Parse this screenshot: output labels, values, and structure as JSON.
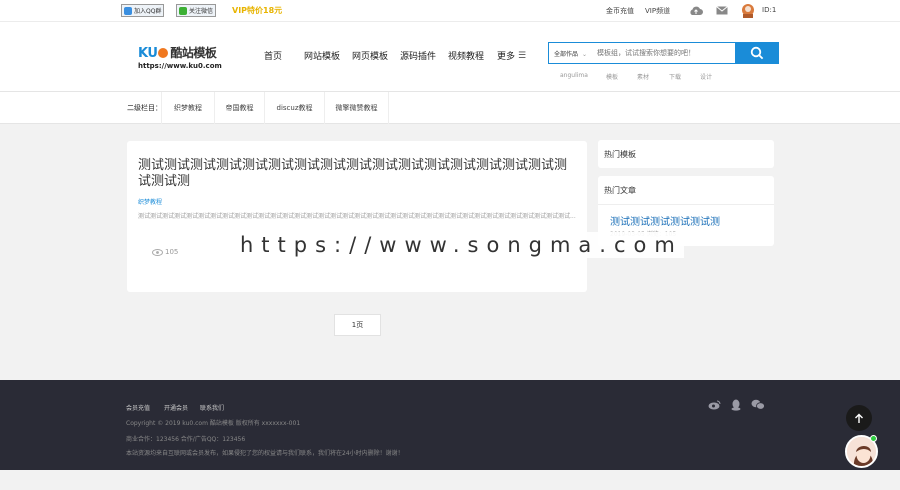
{
  "topbar": {
    "qq_group": "加入QQ群",
    "wechat_follow": "关注微信",
    "vip_promo": "VIP特价18元",
    "links": [
      "金币充值",
      "VIP频道"
    ],
    "user_id": "ID:1"
  },
  "header": {
    "logo_brand": "KU",
    "logo_name": "酷站模板",
    "logo_url": "https://www.ku0.com",
    "nav": [
      "首页",
      "网站模板",
      "网页模板",
      "源码插件",
      "视频教程",
      "更多"
    ],
    "search": {
      "category": "全部作品",
      "placeholder": "模板组，试试搜索你想要的吧！"
    },
    "hot_keywords": [
      "angulima",
      "模板",
      "素材",
      "下载",
      "设计"
    ]
  },
  "subnav": {
    "label": "二级栏目：",
    "items": [
      "织梦教程",
      "帝国教程",
      "discuz教程",
      "微擎微赞教程"
    ]
  },
  "article": {
    "title": "测试测试测试测试测试测试测试测试测试测试测试测试测试测试测试测试测试测试测",
    "category": "织梦教程",
    "excerpt": "测试测试测试测试测试测试测试测试测试测试测试测试测试测试测试测试测试测试测试测试测试测试测试测试测试测试测试测试测试测试测试测试测试测试测试测试...",
    "views": "105"
  },
  "watermark": "https://www.songma.com",
  "sidebar": {
    "hot_templates_title": "热门模板",
    "hot_articles_title": "热门文章",
    "hot_article": {
      "title": "测试测试测试测试测试测",
      "meta": "2019-03-05 浏览：105"
    }
  },
  "pagination": {
    "current": "1页"
  },
  "footer": {
    "links": [
      "会员充值",
      "开通会员",
      "联系我们"
    ],
    "copyright": "Copyright © 2019 ku0.com 酷站模板 版权所有 xxxxxxx-001",
    "contact": "商业合作：123456   合作/广告QQ：123456",
    "notice": "本站资源均来自互联网或会员发布，如果侵犯了您的权益请与我们联系，我们将在24小时内删除！谢谢！"
  },
  "colors": {
    "accent": "#1a8cd8",
    "vip": "#e8b400",
    "footer_bg": "#2a2b36"
  }
}
